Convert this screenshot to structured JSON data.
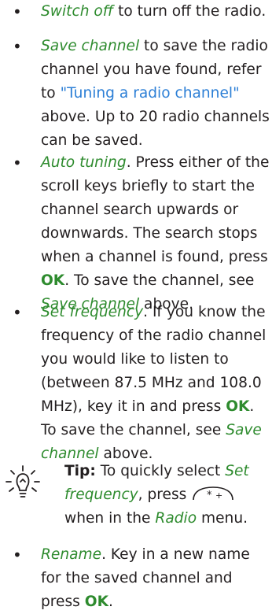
{
  "items": [
    {
      "link": "Switch off",
      "text": " to turn off the radio."
    },
    {
      "link": "Save channel",
      "text1": " to save the radio channel you have found, refer to ",
      "ref": "\"Tuning a radio channel\"",
      "text2": " above. Up to 20 radio channels can be saved."
    },
    {
      "link": "Auto tuning",
      "text1": ". Press either of the scroll keys briefly to start the channel search upwards or downwards. The search stops when a channel is found, press ",
      "ok": "OK",
      "text2": ". To save the channel, see ",
      "link2": "Save channel",
      "text3": " above."
    },
    {
      "link": "Set frequency",
      "text1": ". If you know the frequency of the radio channel you would like to listen to (between 87.5 MHz and 108.0 MHz), key it in and press ",
      "ok": "OK",
      "text2": ". To save the channel, see ",
      "link2": "Save channel",
      "text3": " above."
    },
    {
      "link": "Rename",
      "text1": ". Key in a new name for the saved channel and press ",
      "ok": "OK",
      "text2": "."
    }
  ],
  "tip": {
    "label": "Tip:",
    "text1": " To quickly select ",
    "link": "Set frequency",
    "text2": ", press ",
    "key_icon": "star-key-icon",
    "text3": " when in the ",
    "menu": "Radio",
    "text4": " menu."
  },
  "bullet_char": "•",
  "colors": {
    "link": "#2e8b2e",
    "ref": "#2c7fd6",
    "text": "#231f20"
  }
}
